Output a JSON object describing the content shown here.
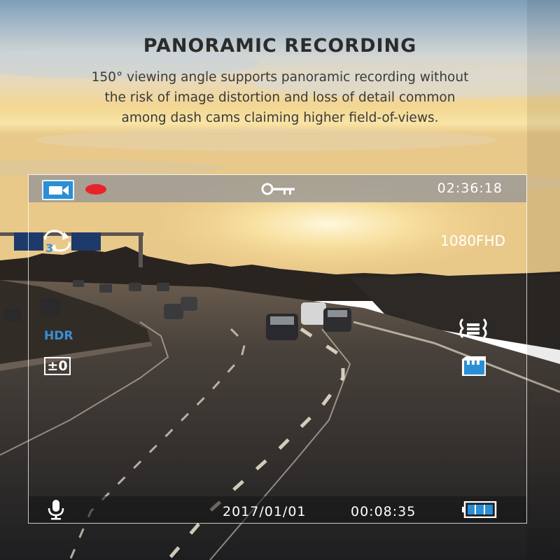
{
  "header": {
    "title": "PANORAMIC RECORDING",
    "description_lines": [
      "150° viewing angle supports panoramic recording  without",
      "the risk of image distortion and loss of detail common",
      "among dash cams claiming higher field-of-views."
    ]
  },
  "screen": {
    "top_bar": {
      "mode_icon": "video-camera-icon",
      "recording_indicator": "record-dot",
      "lock_icon": "key-icon",
      "elapsed_time": "02:36:18"
    },
    "resolution": "1080FHD",
    "loop": {
      "icon": "loop-recording-icon",
      "minutes": "3"
    },
    "hdr_label": "HDR",
    "exposure_label": "±0",
    "gsensor_icon": "g-sensor-icon",
    "sd_card_icon": "sd-card-icon",
    "bottom_bar": {
      "mic_icon": "microphone-icon",
      "date": "2017/01/01",
      "clock": "00:08:35",
      "battery_icon": "battery-icon",
      "battery_level": 1.0
    }
  },
  "colors": {
    "accent_blue": "#2a8fd6",
    "record_red": "#e8232c",
    "title_text": "#2c2c2c"
  }
}
